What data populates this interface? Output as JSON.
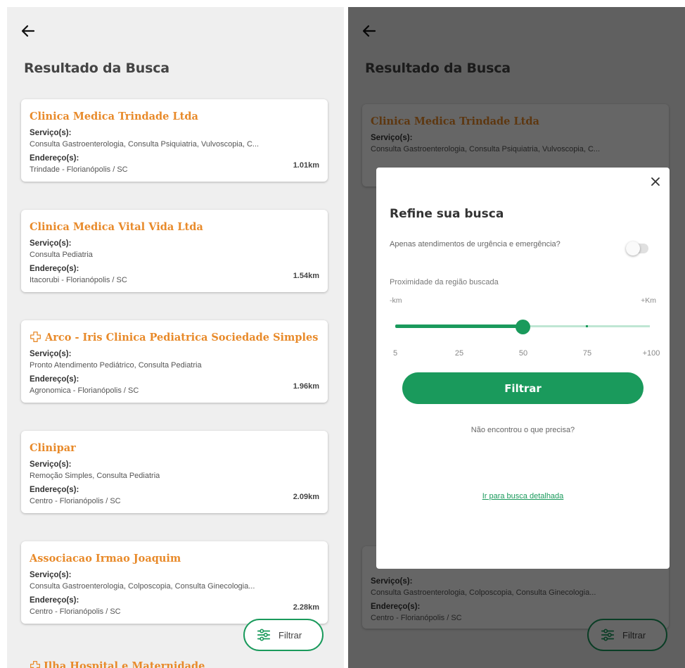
{
  "page_title": "Resultado da Busca",
  "labels": {
    "servicos": "Serviço(s):",
    "enderecos": "Endereço(s):"
  },
  "results": [
    {
      "name": "Clinica Medica Trindade Ltda",
      "services": "Consulta Gastroenterologia, Consulta Psiquiatria, Vulvoscopia, C...",
      "address": "Trindade - Florianópolis / SC",
      "distance": "1.01km"
    },
    {
      "name": "Clinica Medica Vital Vida Ltda",
      "services": "Consulta Pediatria",
      "address": "Itacorubi - Florianópolis / SC",
      "distance": "1.54km"
    },
    {
      "name": "Arco - Iris Clinica Pediatrica Sociedade Simples",
      "services": "Pronto Atendimento Pediátrico, Consulta Pediatria",
      "address": "Agronomica - Florianópolis / SC",
      "distance": "1.96km"
    },
    {
      "name": "Clinipar",
      "services": "Remoção Simples, Consulta Pediatria",
      "address": "Centro - Florianópolis / SC",
      "distance": "2.09km"
    },
    {
      "name": "Associacao Irmao Joaquim",
      "services": "Consulta Gastroenterologia, Colposcopia, Consulta Ginecologia...",
      "address": "Centro - Florianópolis / SC",
      "distance": "2.28km"
    }
  ],
  "peek_name": "Ilha Hospital e Maternidade",
  "fab_label": "Filtrar",
  "modal": {
    "title": "Refine sua busca",
    "urgency_label": "Apenas atendimentos de urgência e emergência?",
    "urgency_on": false,
    "proximity_label": "Proximidade da região buscada",
    "range_min_label": "-km",
    "range_max_label": "+Km",
    "slider_ticks": [
      "5",
      "25",
      "50",
      "75",
      "+100"
    ],
    "slider_selected_index": 2,
    "filter_button": "Filtrar",
    "not_found": "Não encontrou o que precisa?",
    "detail_link": "Ir para busca detalhada"
  },
  "colors": {
    "accent": "#1a9a5c",
    "name": "#e88a2a"
  },
  "icons": {
    "back": "arrow-left-icon",
    "close": "close-icon",
    "filter": "sliders-icon",
    "emergency": "medical-cross-icon"
  }
}
